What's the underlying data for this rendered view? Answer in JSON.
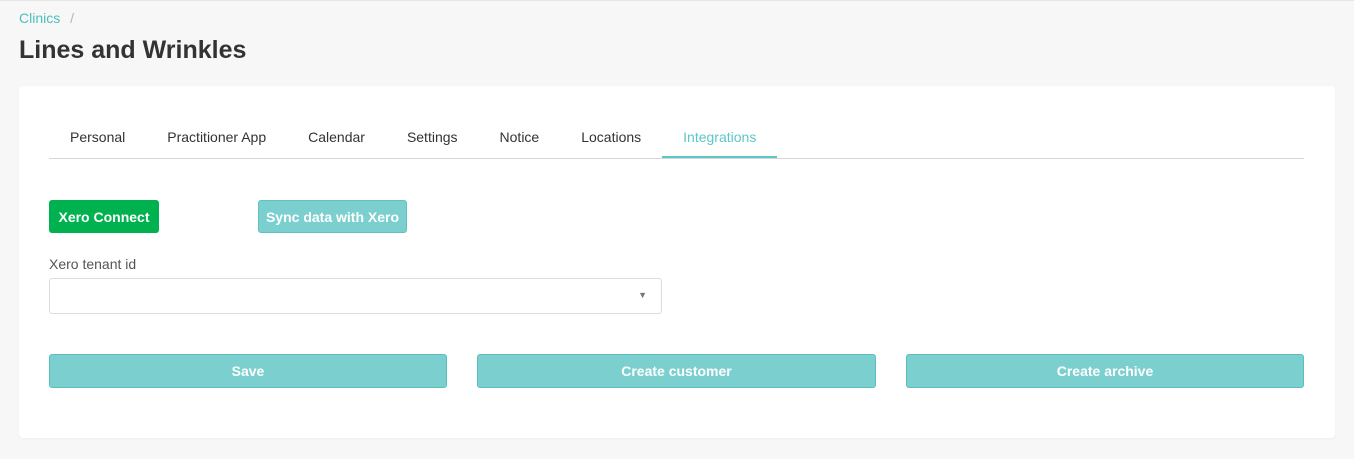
{
  "breadcrumb": {
    "link": "Clinics",
    "separator": "/"
  },
  "page_title": "Lines and Wrinkles",
  "tabs": [
    {
      "label": "Personal",
      "active": false
    },
    {
      "label": "Practitioner App",
      "active": false
    },
    {
      "label": "Calendar",
      "active": false
    },
    {
      "label": "Settings",
      "active": false
    },
    {
      "label": "Notice",
      "active": false
    },
    {
      "label": "Locations",
      "active": false
    },
    {
      "label": "Integrations",
      "active": true
    }
  ],
  "integrations": {
    "xero_connect_label": "Xero Connect",
    "sync_label": "Sync data with Xero",
    "tenant_field_label": "Xero tenant id",
    "tenant_value": ""
  },
  "actions": {
    "save_label": "Save",
    "create_customer_label": "Create customer",
    "create_archive_label": "Create archive"
  },
  "colors": {
    "accent": "#5ec6c6",
    "xero_green": "#00b14f",
    "button_teal": "#7bd0cf"
  },
  "icons": {
    "select_caret": "chevron-down-icon"
  }
}
